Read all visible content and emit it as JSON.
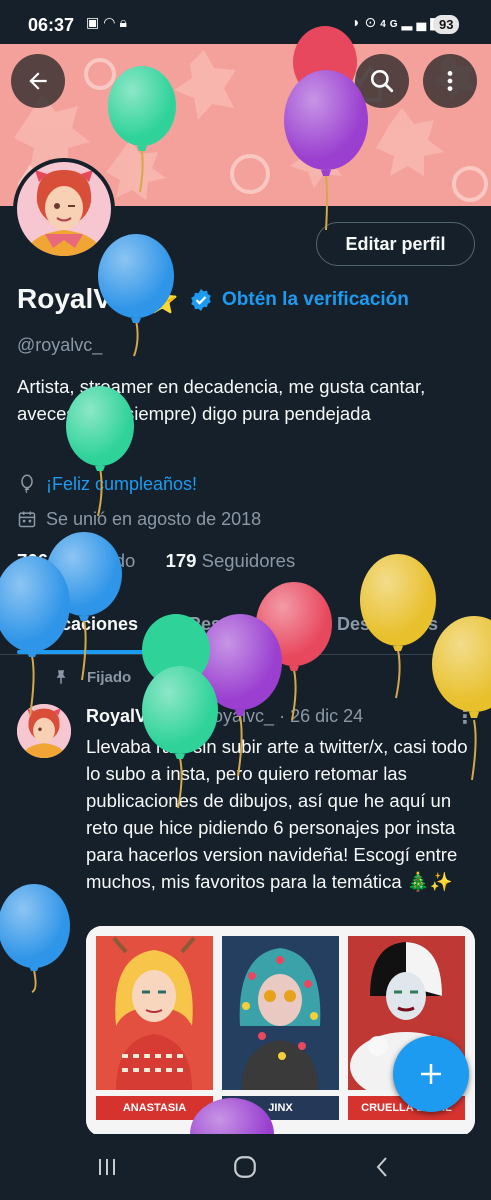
{
  "status_bar": {
    "time": "06:37",
    "left_icons": [
      "screenshot-icon",
      "wifi-icon",
      "lock-icon"
    ],
    "right_icons": [
      "mute-icon",
      "location-icon",
      "signal-4g-icon"
    ],
    "signal_label": "4G",
    "battery": "93"
  },
  "header": {
    "back_icon": "arrow-left-icon",
    "search_icon": "search-icon",
    "more_icon": "more-vertical-icon",
    "banner_color": "#f4a19c"
  },
  "profile": {
    "edit_button": "Editar perfil",
    "display_name": "RoyalVC",
    "name_emoji": "⭐",
    "verify_link": "Obtén la verificación",
    "handle": "@royalvc_",
    "bio": "Artista, streamer en decadencia, me gusta cantar, aveces (casi siempre) digo pura pendejada",
    "birthday": "¡Feliz cumpleaños!",
    "joined": "Se unió en agosto de 2018",
    "following_count": "766",
    "following_label": "Siguiendo",
    "followers_count": "179",
    "followers_label": "Seguidores"
  },
  "tabs": [
    {
      "label": "Publicaciones",
      "active": true
    },
    {
      "label": "Respuestas",
      "active": false
    },
    {
      "label": "Destacados",
      "active": false
    }
  ],
  "pinned_post": {
    "pinned_label": "Fijado",
    "author": "RoyalVC",
    "author_emoji": "⭐",
    "handle": "@royalvc_",
    "date": "26 dic 24",
    "text": "Llevaba rato sin subir arte a twitter/x, casi todo lo subo a insta, pero quiero retomar las publicaciones de dibujos, así que he aquí un reto que hice pidiendo 6 personajes por insta para hacerlos version navideña! Escogí entre muchos, mis favoritos para la temática 🎄✨",
    "image_labels": [
      "ANASTASIA",
      "JINX",
      "CRUELLA DE VIL"
    ]
  },
  "fab": {
    "icon": "plus-icon"
  },
  "nav_bar": {
    "icons": [
      "recent-apps-icon",
      "home-icon",
      "back-icon"
    ]
  },
  "colors": {
    "background": "#15202b",
    "accent": "#1d9bf0",
    "secondary_text": "#8b98a5",
    "balloon_green": "#2fd39a",
    "balloon_blue": "#2f95e8",
    "balloon_purple": "#9a3fd0",
    "balloon_red": "#e8485e",
    "balloon_yellow": "#e8c02c"
  }
}
